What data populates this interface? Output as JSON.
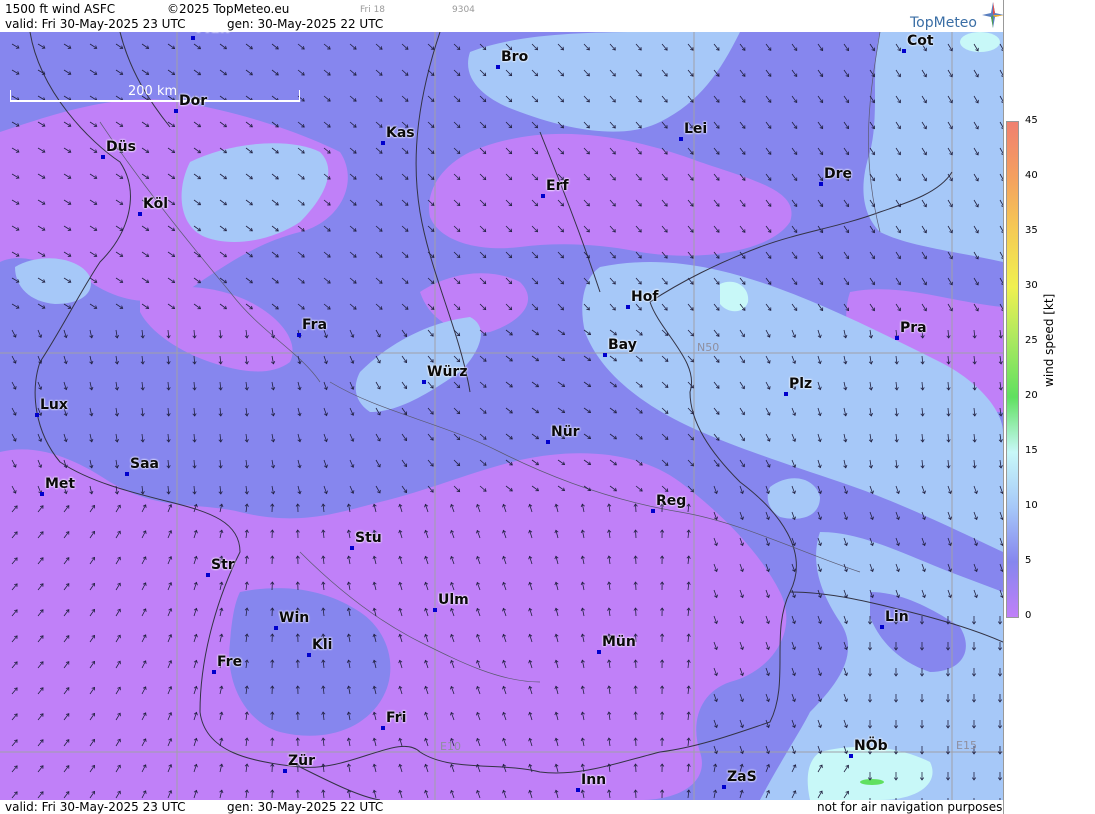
{
  "header": {
    "product": "1500 ft wind ASFC",
    "copyright": "©2025 TopMeteo.eu",
    "run_code": "Fri 18",
    "id_code": "9304",
    "valid": "valid:  Fri  30-May-2025  23 UTC",
    "generated": "gen:  30-May-2025 22 UTC",
    "logo": "TopMeteo"
  },
  "footer": {
    "valid": "valid:  Fri  30-May-2025  23 UTC",
    "generated": "gen:  30-May-2025 22 UTC",
    "disclaimer": "not for air navigation purposes"
  },
  "scale": {
    "label": "200 km"
  },
  "grid_labels": {
    "lat": "N50",
    "lon1": "E10",
    "lon2": "E15"
  },
  "cities": [
    {
      "name": "Mün"
    },
    {
      "name": "Bro"
    },
    {
      "name": "Cot"
    },
    {
      "name": "Dor"
    },
    {
      "name": "Kas"
    },
    {
      "name": "Lei"
    },
    {
      "name": "Düs"
    },
    {
      "name": "Erf"
    },
    {
      "name": "Dre"
    },
    {
      "name": "Köl"
    },
    {
      "name": "Hof"
    },
    {
      "name": "Pra"
    },
    {
      "name": "Fra"
    },
    {
      "name": "Bay"
    },
    {
      "name": "Würz"
    },
    {
      "name": "Plz"
    },
    {
      "name": "Lux"
    },
    {
      "name": "Nür"
    },
    {
      "name": "Saa"
    },
    {
      "name": "Met"
    },
    {
      "name": "Reg"
    },
    {
      "name": "Stu"
    },
    {
      "name": "Str"
    },
    {
      "name": "Ulm"
    },
    {
      "name": "Win"
    },
    {
      "name": "Lin"
    },
    {
      "name": "Kli"
    },
    {
      "name": "Mün"
    },
    {
      "name": "Fre"
    },
    {
      "name": "Fri"
    },
    {
      "name": "NÖb"
    },
    {
      "name": "Zür"
    },
    {
      "name": "ZaS"
    },
    {
      "name": "Inn"
    }
  ],
  "legend": {
    "title": "wind speed [kt]",
    "ticks": [
      "45",
      "40",
      "35",
      "30",
      "25",
      "20",
      "15",
      "10",
      "5",
      "0"
    ],
    "colors": [
      "#f08070",
      "#f4a060",
      "#f5cc55",
      "#f0f050",
      "#a8e860",
      "#60e060",
      "#c8f8f8",
      "#a6c8f8",
      "#8686ee",
      "#c080f8"
    ]
  },
  "map_colors": {
    "calm": "#c080f8",
    "light": "#8686ee",
    "moderate": "#a6c8f8",
    "fresh": "#c8f8f8",
    "strong": "#60e060",
    "border": "#333344",
    "grid": "#a0a0a8"
  }
}
